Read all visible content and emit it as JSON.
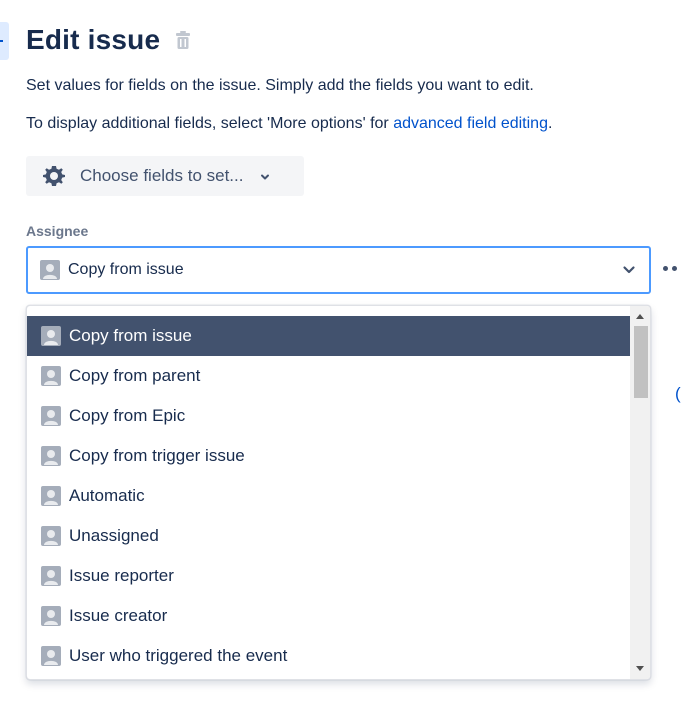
{
  "header": {
    "title": "Edit issue",
    "delete_icon": "trash-icon"
  },
  "description": {
    "line1": "Set values for fields on the issue. Simply add the fields you want to edit.",
    "line2_prefix": "To display additional fields, select 'More options' for ",
    "line2_link": "advanced field editing",
    "line2_suffix": "."
  },
  "choose_fields": {
    "label": "Choose fields to set...",
    "icon": "gear-icon"
  },
  "assignee": {
    "label": "Assignee",
    "selected_value": "Copy from issue",
    "options": [
      "Copy from issue",
      "Copy from parent",
      "Copy from Epic",
      "Copy from trigger issue",
      "Automatic",
      "Unassigned",
      "Issue reporter",
      "Issue creator",
      "User who triggered the event"
    ],
    "selected_index": 0
  },
  "colors": {
    "accent": "#4c9aff",
    "link": "#0052cc",
    "selected_bg": "#42526e",
    "text": "#172b4d"
  }
}
